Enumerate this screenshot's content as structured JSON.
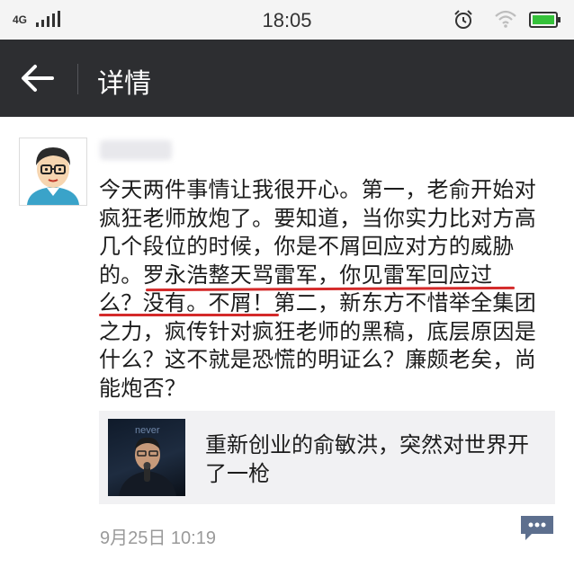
{
  "status_bar": {
    "network": "4G",
    "time": "18:05"
  },
  "nav": {
    "title": "详情"
  },
  "post": {
    "author": "",
    "lines": [
      "今天两件事情让我很开心。第一，老俞开始对",
      "疯狂老师放炮了。要知道，当你实力比对方高",
      "几个段位的时候，你是不屑回应对方的威胁",
      "的。罗永浩整天骂雷军，你见雷军回应过",
      "么？没有。不屑！第二，新东方不惜举全集团",
      "之力，疯传针对疯狂老师的黑稿，底层原因是",
      "什么？这不就是恐慌的明证么？廉颇老矣，尚",
      "能炮否？"
    ],
    "link_card": {
      "title": "重新创业的俞敏洪，突然对世界开了一枪",
      "thumb_text": "never"
    },
    "timestamp": "9月25日 10:19"
  },
  "colors": {
    "nav_bg": "#2d2e31",
    "highlight_underline": "#d42a2a",
    "battery_green": "#35c23a",
    "card_bg": "#f1f1f3",
    "comment_icon": "#5d6f8e"
  },
  "icons": {
    "back": "arrow-left-icon",
    "alarm": "alarm-clock-icon",
    "wifi": "wifi-icon",
    "battery": "battery-icon",
    "signal": "signal-bars-icon",
    "comment": "comment-bubble-icon"
  }
}
